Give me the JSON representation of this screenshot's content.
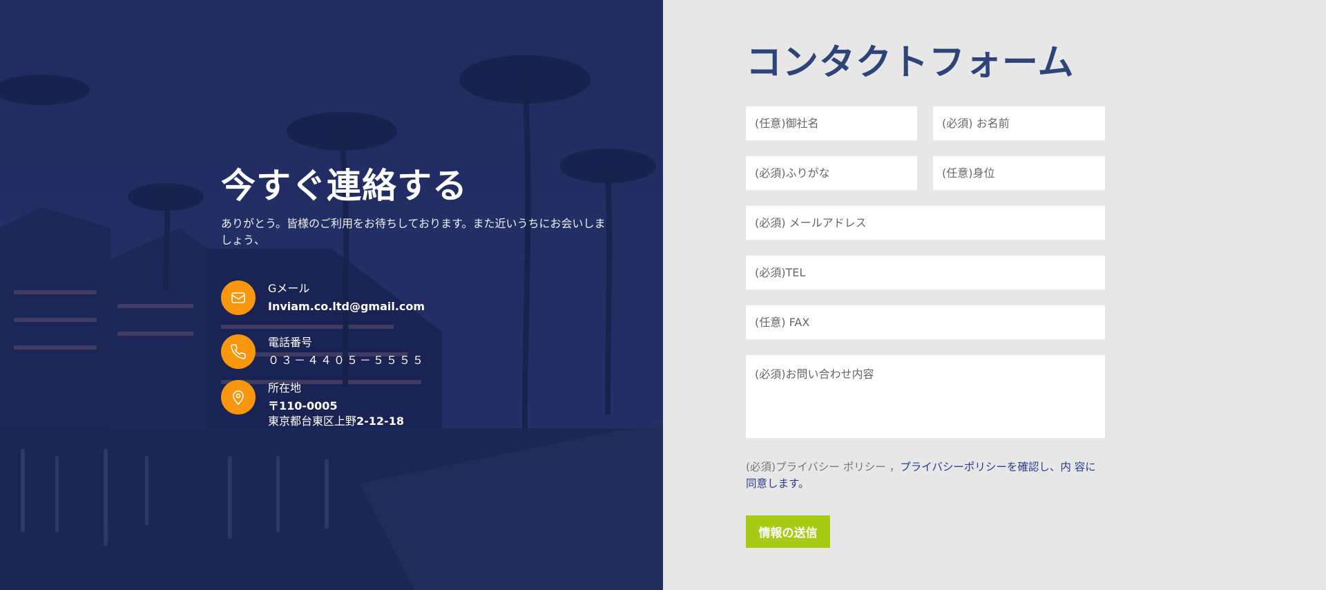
{
  "contact_info": {
    "headline": "今すぐ連絡する",
    "intro": "ありがとう。皆様のご利用をお待ちしております。また近いうちにお会いしましょう、",
    "items": [
      {
        "icon": "mail-icon",
        "label": "Gメール",
        "value": "Inviam.co.ltd@gmail.com"
      },
      {
        "icon": "phone-icon",
        "label": "電話番号",
        "value": "０３－４４０５－５５５５"
      },
      {
        "icon": "location-pin-icon",
        "label": "所在地",
        "value": "〒110-0005",
        "value2_prefix": "東京都台東区上野",
        "value2_bold": "2-12-18"
      }
    ]
  },
  "form": {
    "title": "コンタクトフォーム",
    "fields": {
      "company": "(任意)御社名",
      "name": "(必須) お名前",
      "furigana": "(必須)ふりがな",
      "position": "(任意)身位",
      "email": "(必須) メールアドレス",
      "tel": "(必須)TEL",
      "fax": "(任意) FAX",
      "message": "(必須)お問い合わせ内容"
    },
    "policy_prefix": "(必須)プライバシー ポリシー ，",
    "policy_link": "プライバシーポリシーを確認し、内 容に同意します。",
    "submit_label": "情報の送信"
  },
  "colors": {
    "left_overlay": "#1e2a5c",
    "icon_accent": "#f8960e",
    "title": "#2c4477",
    "submit": "#a8cc16",
    "link": "#2a3c8f"
  }
}
